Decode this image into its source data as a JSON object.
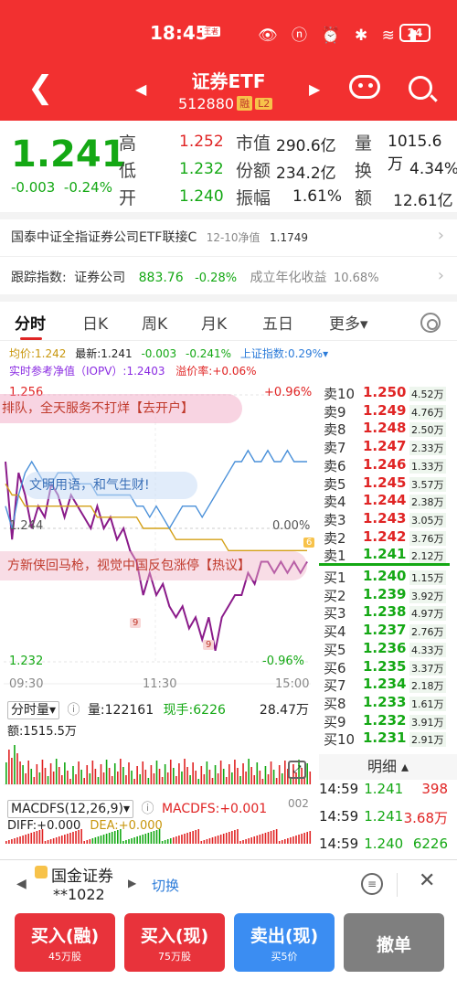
{
  "status": {
    "time": "18:45",
    "badge": "王者",
    "battery": "24"
  },
  "header": {
    "title": "证券ETF",
    "code": "512880",
    "tag1": "融",
    "tag2": "L2"
  },
  "quote": {
    "price": "1.241",
    "change": "-0.003",
    "change_pct": "-0.24%",
    "high_label": "高",
    "high": "1.252",
    "low_label": "低",
    "low": "1.232",
    "open_label": "开",
    "open": "1.240",
    "mcap_label": "市值",
    "mcap": "290.6亿",
    "shares_label": "份额",
    "shares": "234.2亿",
    "amp_label": "振幅",
    "amp": "1.61%",
    "vol_label": "量",
    "vol": "1015.6万",
    "turn_label": "换",
    "turn": "4.34%",
    "amt_label": "额",
    "amt": "12.61亿"
  },
  "fund": {
    "name": "国泰中证全指证券公司ETF联接C",
    "nav_label": "12-10净值",
    "nav": "1.1749"
  },
  "index": {
    "label": "跟踪指数:",
    "name": "证券公司",
    "value": "883.76",
    "change": "-0.28%",
    "yield_label": "成立年化收益",
    "yield": "10.68%"
  },
  "tabs": [
    "分时",
    "日K",
    "周K",
    "月K",
    "五日",
    "更多▾"
  ],
  "intraday": {
    "avg": "均价:1.242",
    "last": "最新:1.241",
    "chg": "-0.003",
    "chg_pct": "-0.241%",
    "sh_index": "上证指数:0.29%▾",
    "iopv": "实时参考净值（IOPV）:1.2403",
    "premium": "溢价率:+0.06%",
    "top_price": "1.256",
    "top_pct": "+0.96%",
    "mid_price": "1.244",
    "mid_pct": "0.00%",
    "bot_price": "1.232",
    "bot_pct": "-0.96%",
    "t_start": "09:30",
    "t_mid": "11:30",
    "t_end": "15:00",
    "ad1": "排队，全天服务不打烊【去开户】",
    "ad2": "文明用语，和气生财!",
    "ad3": "方新侠回马枪，视觉中国反包涨停【热议】",
    "marker_a": "6",
    "marker_b": "9",
    "marker_c": "9"
  },
  "chart_data": {
    "type": "line",
    "x_range": [
      "09:30",
      "15:00"
    ],
    "ylim": [
      1.232,
      1.256
    ],
    "series": [
      {
        "name": "最新",
        "values": [
          1.25,
          1.243,
          1.249,
          1.247,
          1.244,
          1.246,
          1.245,
          1.248,
          1.247,
          1.245,
          1.247,
          1.246,
          1.245,
          1.244,
          1.246,
          1.244,
          1.245,
          1.243,
          1.244,
          1.242,
          1.241,
          1.238,
          1.24,
          1.238,
          1.239,
          1.237,
          1.236,
          1.237,
          1.235,
          1.236,
          1.234,
          1.236,
          1.233,
          1.236,
          1.237,
          1.238,
          1.238,
          1.24,
          1.239,
          1.241,
          1.241,
          1.24,
          1.241,
          1.24,
          1.241,
          1.24,
          1.241
        ]
      },
      {
        "name": "均价",
        "values": [
          1.248,
          1.247,
          1.247,
          1.246,
          1.246,
          1.246,
          1.246,
          1.246,
          1.246,
          1.246,
          1.246,
          1.246,
          1.246,
          1.246,
          1.245,
          1.245,
          1.245,
          1.245,
          1.245,
          1.245,
          1.245,
          1.244,
          1.244,
          1.244,
          1.244,
          1.244,
          1.243,
          1.243,
          1.243,
          1.243,
          1.243,
          1.243,
          1.243,
          1.243,
          1.242,
          1.242,
          1.242,
          1.242,
          1.242,
          1.242,
          1.242,
          1.242,
          1.242,
          1.242,
          1.242,
          1.242,
          1.242
        ]
      },
      {
        "name": "上证指数",
        "values": [
          1.246,
          1.244,
          1.247,
          1.249,
          1.25,
          1.249,
          1.248,
          1.248,
          1.249,
          1.249,
          1.249,
          1.248,
          1.248,
          1.248,
          1.247,
          1.247,
          1.247,
          1.247,
          1.247,
          1.247,
          1.246,
          1.246,
          1.245,
          1.246,
          1.245,
          1.244,
          1.245,
          1.246,
          1.246,
          1.246,
          1.245,
          1.246,
          1.247,
          1.248,
          1.249,
          1.25,
          1.25,
          1.251,
          1.25,
          1.25,
          1.251,
          1.25,
          1.25,
          1.251,
          1.25,
          1.25,
          1.25
        ]
      }
    ]
  },
  "volume": {
    "label": "分时量▾",
    "vol": "量:122161",
    "cur": "现手:6226",
    "max": "28.47万",
    "amt": "额:1515.5万"
  },
  "macd": {
    "label": "MACDFS(12,26,9)▾",
    "value": "MACDFS:+0.001",
    "dif": "DIFF:+0.000",
    "dea": "DEA:+0.000",
    "right": "002"
  },
  "book": {
    "asks": [
      {
        "label": "卖10",
        "price": "1.250",
        "vol": "4.52万"
      },
      {
        "label": "卖9",
        "price": "1.249",
        "vol": "4.76万"
      },
      {
        "label": "卖8",
        "price": "1.248",
        "vol": "2.50万"
      },
      {
        "label": "卖7",
        "price": "1.247",
        "vol": "2.33万"
      },
      {
        "label": "卖6",
        "price": "1.246",
        "vol": "1.33万"
      },
      {
        "label": "卖5",
        "price": "1.245",
        "vol": "3.57万"
      },
      {
        "label": "卖4",
        "price": "1.244",
        "vol": "2.38万"
      },
      {
        "label": "卖3",
        "price": "1.243",
        "vol": "3.05万"
      },
      {
        "label": "卖2",
        "price": "1.242",
        "vol": "3.76万"
      },
      {
        "label": "卖1",
        "price": "1.241",
        "vol": "2.12万"
      }
    ],
    "bids": [
      {
        "label": "买1",
        "price": "1.240",
        "vol": "1.15万"
      },
      {
        "label": "买2",
        "price": "1.239",
        "vol": "3.92万"
      },
      {
        "label": "买3",
        "price": "1.238",
        "vol": "4.97万"
      },
      {
        "label": "买4",
        "price": "1.237",
        "vol": "2.76万"
      },
      {
        "label": "买5",
        "price": "1.236",
        "vol": "4.33万"
      },
      {
        "label": "买6",
        "price": "1.235",
        "vol": "3.37万"
      },
      {
        "label": "买7",
        "price": "1.234",
        "vol": "2.18万"
      },
      {
        "label": "买8",
        "price": "1.233",
        "vol": "1.61万"
      },
      {
        "label": "买9",
        "price": "1.232",
        "vol": "3.91万"
      },
      {
        "label": "买10",
        "price": "1.231",
        "vol": "2.91万"
      }
    ],
    "detail_label": "明细 ▴",
    "ticks": [
      {
        "time": "14:59",
        "price": "1.241",
        "vol": "398"
      },
      {
        "time": "14:59",
        "price": "1.241",
        "vol": "3.68万"
      },
      {
        "time": "14:59",
        "price": "1.240",
        "vol": "6226"
      }
    ]
  },
  "broker": {
    "name": "国金证券",
    "account": "**1022",
    "switch": "切换"
  },
  "actions": [
    {
      "main": "买入(融)",
      "sub": "45万股"
    },
    {
      "main": "买入(现)",
      "sub": "75万股"
    },
    {
      "main": "卖出(现)",
      "sub": "买5价"
    },
    {
      "main": "撤单",
      "sub": ""
    }
  ],
  "colors": {
    "up": "#e02424",
    "down": "#14a814",
    "price_line": "#8a1b8a",
    "avg_line": "#d4a017",
    "index_line": "#4a90d9"
  }
}
